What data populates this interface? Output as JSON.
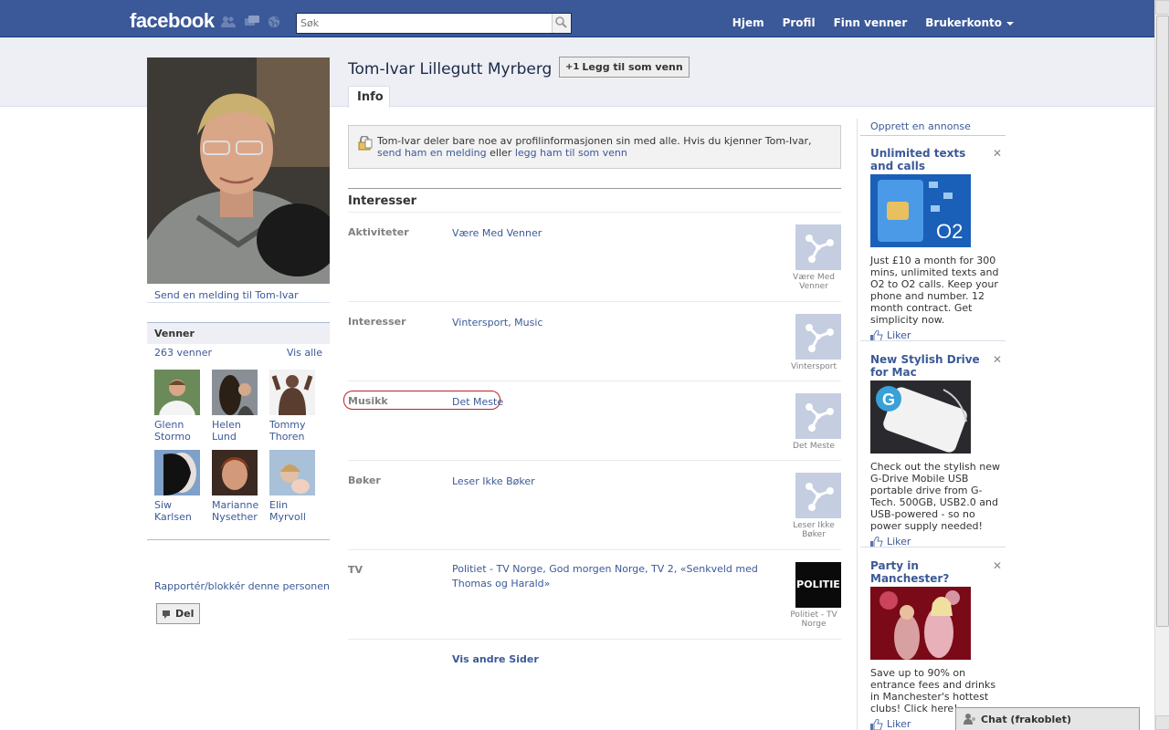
{
  "topbar": {
    "logo": "facebook",
    "search_placeholder": "Søk",
    "nav": [
      "Hjem",
      "Profil",
      "Finn venner",
      "Brukerkonto"
    ]
  },
  "profile": {
    "name": "Tom-Ivar Lillegutt Myrberg",
    "add_friend_label": "Legg til som venn",
    "add_friend_prefix": "+1",
    "tab_info": "Info",
    "send_message": "Send en melding til Tom-Ivar",
    "report": "Rapportér/blokkér denne personen",
    "share_label": "Del"
  },
  "privacy_notice": {
    "text_before": "Tom-Ivar deler bare noe av profilinformasjonen sin med alle. Hvis du kjenner Tom-Ivar, ",
    "link1": "send ham en melding",
    "middle": " eller ",
    "link2": "legg ham til som venn"
  },
  "friends": {
    "title": "Venner",
    "count": "263 venner",
    "see_all": "Vis alle",
    "list": [
      {
        "name": "Glenn Stormo"
      },
      {
        "name": "Helen Lund"
      },
      {
        "name": "Tommy Thoren"
      },
      {
        "name": "Siw Karlsen"
      },
      {
        "name": "Marianne Nysether"
      },
      {
        "name": "Elin Myrvoll"
      }
    ]
  },
  "interests": {
    "section_title": "Interesser",
    "rows": [
      {
        "label": "Aktiviteter",
        "value": "Være Med Venner",
        "thumb_caption": "Være Med Venner"
      },
      {
        "label": "Interesser",
        "value": "Vintersport, Music",
        "thumb_caption": "Vintersport"
      },
      {
        "label": "Musikk",
        "value": "Det Meste",
        "thumb_caption": "Det Meste"
      },
      {
        "label": "Bøker",
        "value": "Leser Ikke Bøker",
        "thumb_caption": "Leser Ikke Bøker"
      },
      {
        "label": "TV",
        "value": "Politiet - TV Norge, God morgen Norge, TV 2, «Senkveld med Thomas og Harald»",
        "thumb_caption": "Politiet - TV Norge",
        "thumb_text": "POLITIE"
      }
    ],
    "more_pages": "Vis andre Sider"
  },
  "ads": {
    "create": "Opprett en annonse",
    "like_label": "Liker",
    "items": [
      {
        "title": "Unlimited texts and calls",
        "body": "Just £10 a month for 300 mins, unlimited texts and O2 to O2 calls. Keep your phone and number. 12 month contract. Get simplicity now.",
        "brand": "O2"
      },
      {
        "title": "New Stylish Drive for Mac",
        "body": "Check out the stylish new G-Drive Mobile USB portable drive from G-Tech. 500GB, USB2.0 and USB-powered - so no power supply needed!",
        "brand": "G"
      },
      {
        "title": "Party in Manchester?",
        "body": "Save up to 90% on entrance fees and drinks in Manchester's hottest clubs! Click here!"
      }
    ]
  },
  "chat": {
    "label": "Chat (frakoblet)"
  },
  "colors": {
    "brand": "#3b5998",
    "band": "#edeff4",
    "highlight": "#c0202a"
  }
}
